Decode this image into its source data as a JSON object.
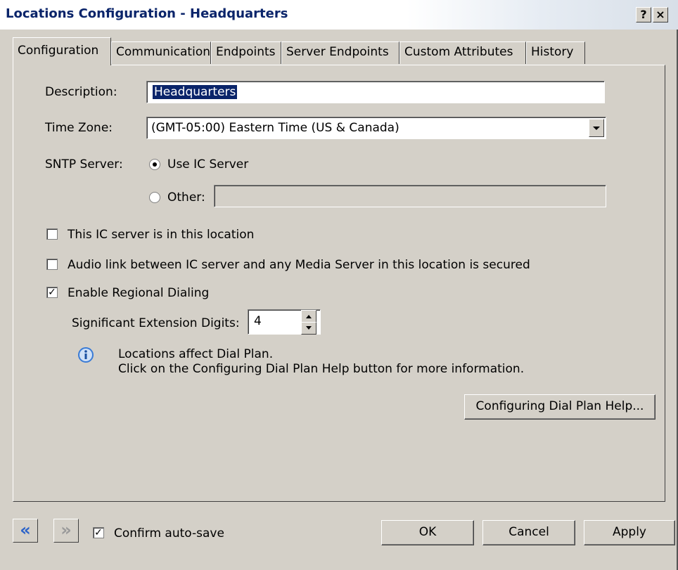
{
  "window": {
    "title": "Locations Configuration - Headquarters",
    "help_label": "?",
    "close_label": "×"
  },
  "tabs": [
    {
      "label": "Configuration"
    },
    {
      "label": "Communication"
    },
    {
      "label": "Endpoints"
    },
    {
      "label": "Server Endpoints"
    },
    {
      "label": "Custom Attributes"
    },
    {
      "label": "History"
    }
  ],
  "config": {
    "description_label": "Description:",
    "description_value": "Headquarters",
    "timezone_label": "Time Zone:",
    "timezone_value": "(GMT-05:00) Eastern Time (US & Canada)",
    "sntp_label": "SNTP Server:",
    "use_ic_label": "Use IC Server",
    "other_label": "Other:",
    "other_value": "",
    "ic_in_location_label": "This IC server is in this location",
    "audio_secured_label": "Audio link between IC server and any Media Server in this location is secured",
    "regional_dialing_label": "Enable Regional Dialing",
    "sig_digits_label": "Significant Extension Digits:",
    "sig_digits_value": "4",
    "info_line1": "Locations affect Dial Plan.",
    "info_line2": "Click on the Configuring Dial Plan Help button for more information.",
    "help_button": "Configuring Dial Plan Help..."
  },
  "footer": {
    "confirm_label": "Confirm auto-save",
    "ok": "OK",
    "cancel": "Cancel",
    "apply": "Apply"
  },
  "colors": {
    "title_text": "#0a246a",
    "highlight": "#0a246a",
    "dialog_bg": "#d4d0c8",
    "info_icon": "#3a7bd5",
    "nav_active": "#2a62c9"
  }
}
